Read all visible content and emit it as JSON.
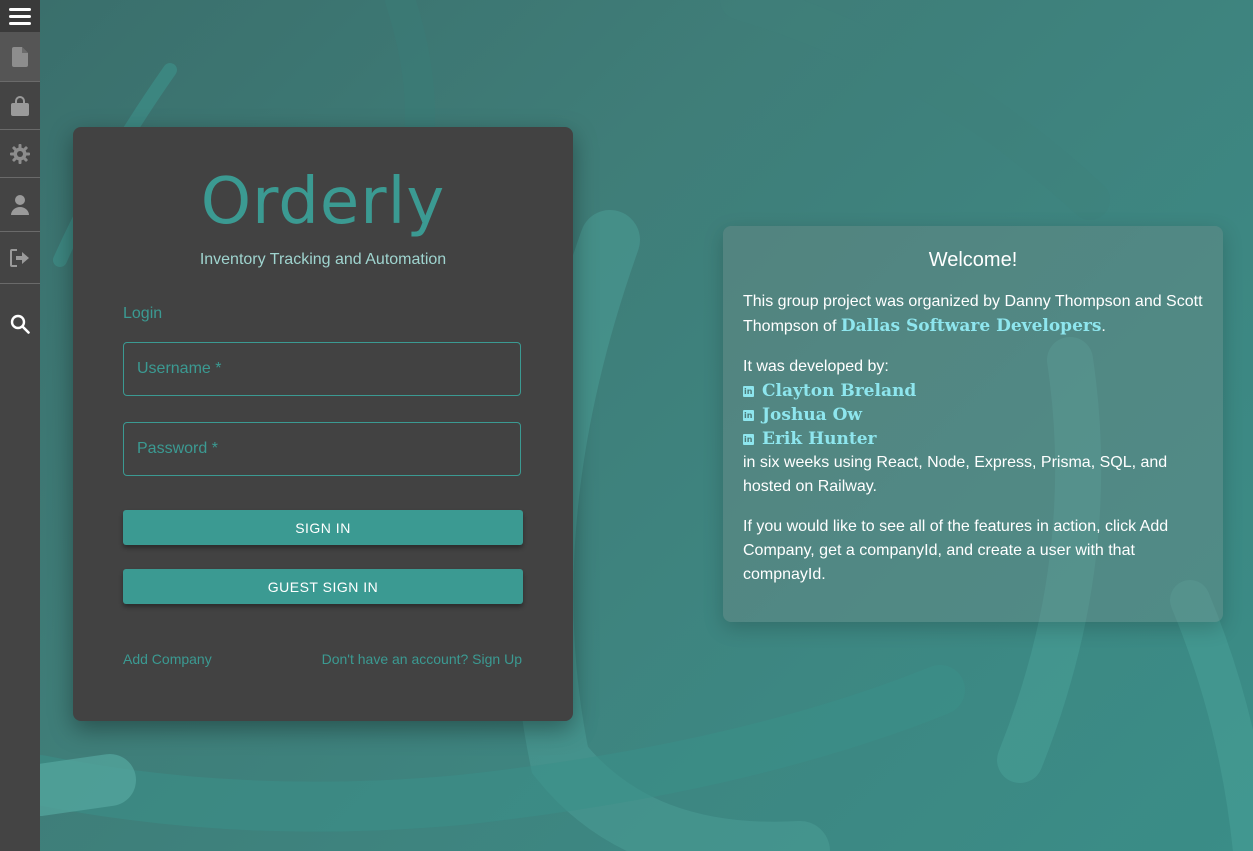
{
  "sidebar": {
    "items": [
      {
        "name": "menu",
        "icon": "menu-icon"
      },
      {
        "name": "documents",
        "icon": "file-icon"
      },
      {
        "name": "products",
        "icon": "shopping-bag-icon"
      },
      {
        "name": "settings",
        "icon": "gear-icon"
      },
      {
        "name": "account",
        "icon": "user-icon"
      },
      {
        "name": "logout",
        "icon": "logout-icon"
      },
      {
        "name": "search",
        "icon": "search-icon"
      }
    ]
  },
  "login": {
    "brand": "Orderly",
    "tagline": "Inventory Tracking and Automation",
    "section_label": "Login",
    "username_placeholder": "Username *",
    "password_placeholder": "Password *",
    "signin_label": "SIGN IN",
    "guest_signin_label": "GUEST SIGN IN",
    "add_company_label": "Add Company",
    "signup_label": "Don't have an account? Sign Up"
  },
  "welcome": {
    "title": "Welcome!",
    "intro_prefix": "This group project was organized by Danny Thompson and Scott Thompson of ",
    "org_link": "Dallas Software Developers",
    "intro_suffix": ".",
    "developed_by": "It was developed by:",
    "developers": [
      "Clayton Breland",
      "Joshua Ow",
      "Erik Hunter"
    ],
    "tech": "in six weeks using React, Node, Express, Prisma, SQL, and hosted on Railway.",
    "features": "If you would like to see all of the features in action, click Add Company, get a companyId, and create a user with that compnayId."
  },
  "colors": {
    "accent": "#3b9a92",
    "link": "#8ee6ee",
    "card": "#424242",
    "sidebar": "#444444"
  }
}
